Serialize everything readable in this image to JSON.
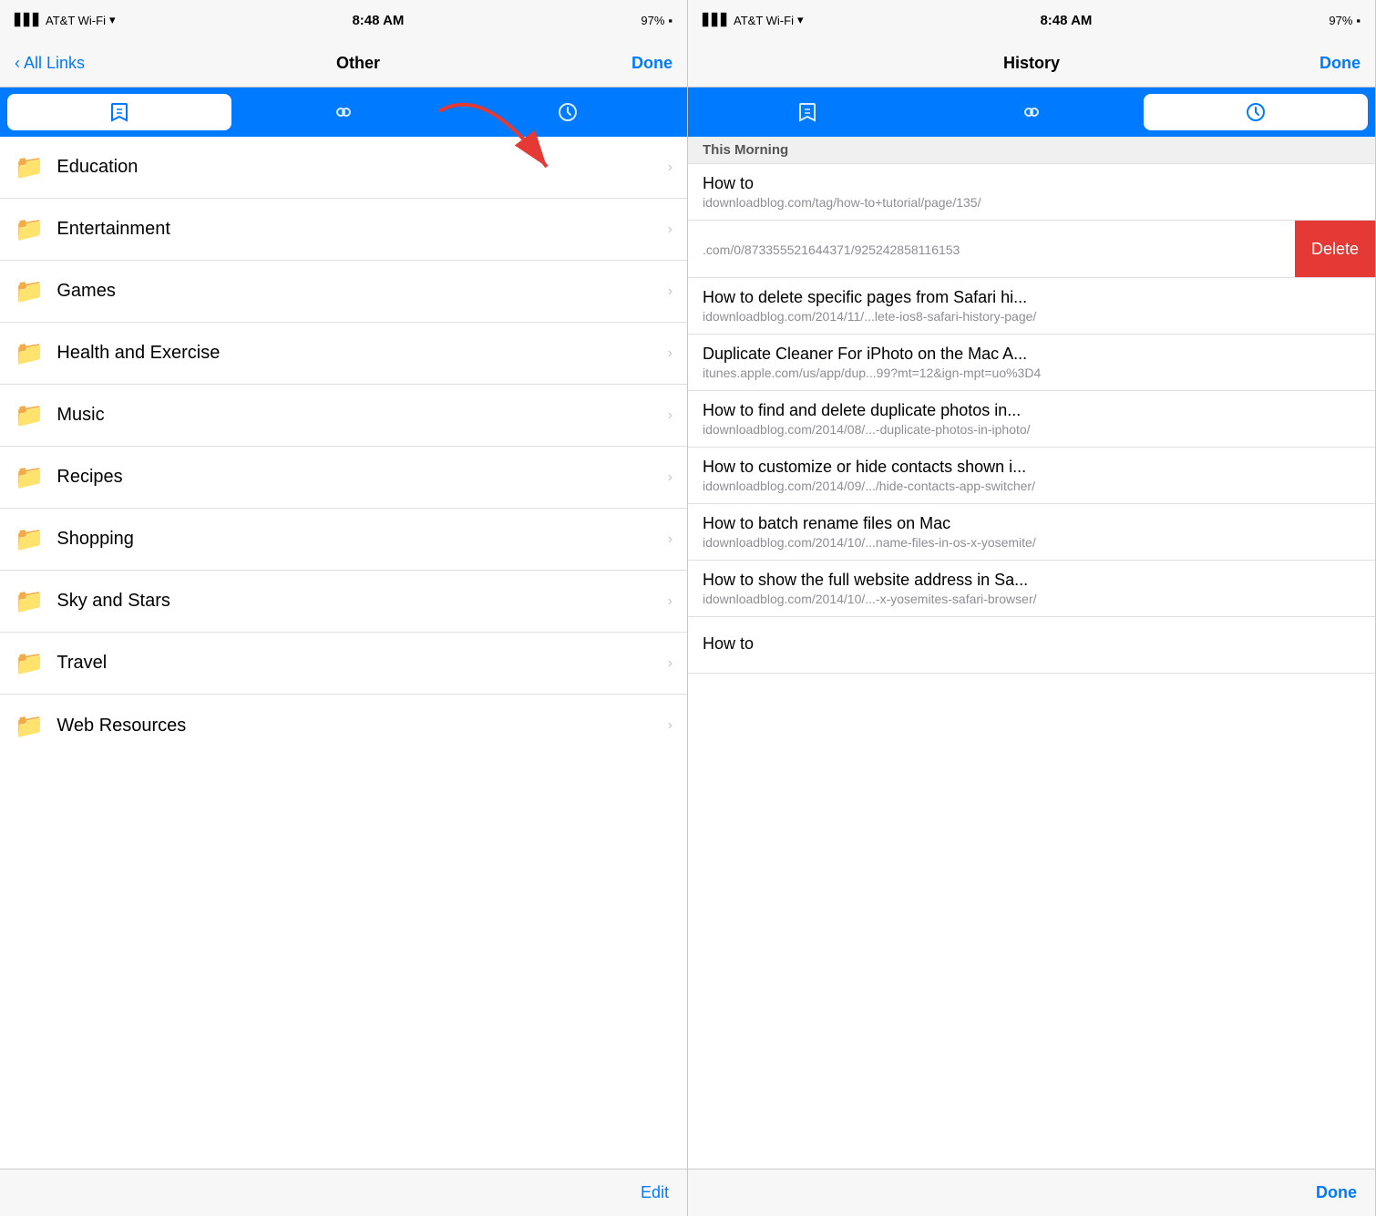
{
  "left": {
    "statusBar": {
      "carrier": "AT&T Wi-Fi",
      "time": "8:48 AM",
      "battery": "97%"
    },
    "navBar": {
      "backLabel": "All Links",
      "title": "Other",
      "rightLabel": "Done"
    },
    "segments": [
      {
        "icon": "bookmarks",
        "active": true
      },
      {
        "icon": "reading-list",
        "active": false
      },
      {
        "icon": "history",
        "active": false
      }
    ],
    "listItems": [
      {
        "label": "Education"
      },
      {
        "label": "Entertainment"
      },
      {
        "label": "Games"
      },
      {
        "label": "Health and Exercise"
      },
      {
        "label": "Music"
      },
      {
        "label": "Recipes"
      },
      {
        "label": "Shopping"
      },
      {
        "label": "Sky and Stars"
      },
      {
        "label": "Travel"
      },
      {
        "label": "Web Resources"
      }
    ],
    "bottomBar": {
      "editLabel": "Edit"
    }
  },
  "right": {
    "statusBar": {
      "carrier": "AT&T Wi-Fi",
      "time": "8:48 AM",
      "battery": "97%"
    },
    "navBar": {
      "title": "History",
      "rightLabel": "Done"
    },
    "segments": [
      {
        "icon": "bookmarks",
        "active": false
      },
      {
        "icon": "reading-list",
        "active": false
      },
      {
        "icon": "history",
        "active": true
      }
    ],
    "sectionHeader": "This Morning",
    "historyItems": [
      {
        "title": "How to",
        "url": "idownloadblog.com/tag/how-to+tutorial/page/135/",
        "swiped": false
      },
      {
        "title": "",
        "url": ".com/0/873355521644371/925242858116153",
        "swiped": true
      },
      {
        "title": "How to delete specific pages from Safari hi...",
        "url": "idownloadblog.com/2014/11/...lete-ios8-safari-history-page/",
        "swiped": false
      },
      {
        "title": "Duplicate Cleaner For iPhoto on the Mac A...",
        "url": "itunes.apple.com/us/app/dup...99?mt=12&ign-mpt=uo%3D4",
        "swiped": false
      },
      {
        "title": "How to find and delete duplicate photos in...",
        "url": "idownloadblog.com/2014/08/...-duplicate-photos-in-iphoto/",
        "swiped": false
      },
      {
        "title": "How to customize or hide contacts shown i...",
        "url": "idownloadblog.com/2014/09/.../hide-contacts-app-switcher/",
        "swiped": false
      },
      {
        "title": "How to batch rename files on Mac",
        "url": "idownloadblog.com/2014/10/...name-files-in-os-x-yosemite/",
        "swiped": false
      },
      {
        "title": "How to show the full website address in Sa...",
        "url": "idownloadblog.com/2014/10/...-x-yosemites-safari-browser/",
        "swiped": false
      },
      {
        "title": "How to",
        "url": "",
        "swiped": false
      }
    ],
    "deleteLabel": "Delete",
    "bottomBar": {
      "doneLabel": "Done"
    }
  }
}
